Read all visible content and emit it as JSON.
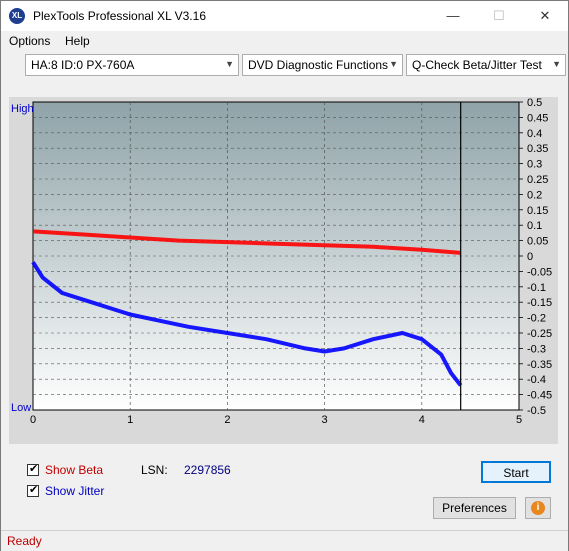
{
  "window": {
    "title": "PlexTools Professional XL V3.16",
    "icon_text": "XL"
  },
  "window_controls": {
    "minimize": "—",
    "maximize": "☐",
    "close": "✕"
  },
  "menu": {
    "items": [
      "Options",
      "Help"
    ]
  },
  "toolbar": {
    "device": "HA:8 ID:0  PX-760A",
    "function": "DVD Diagnostic Functions",
    "test": "Q-Check Beta/Jitter Test"
  },
  "chart": {
    "left_label_high": "High",
    "left_label_low": "Low"
  },
  "chart_data": {
    "type": "line",
    "xlim": [
      0,
      5
    ],
    "ylim": [
      -0.5,
      0.5
    ],
    "x_ticks": [
      "0",
      "1",
      "2",
      "3",
      "4",
      "5"
    ],
    "y_ticks": [
      "0.5",
      "0.45",
      "0.4",
      "0.35",
      "0.3",
      "0.25",
      "0.2",
      "0.15",
      "0.1",
      "0.05",
      "0",
      "-0.05",
      "-0.1",
      "-0.15",
      "-0.2",
      "-0.25",
      "-0.3",
      "-0.35",
      "-0.4",
      "-0.45",
      "-0.5"
    ],
    "end_marker_x": 4.4,
    "series": [
      {
        "color": "#ff0000",
        "x": [
          0,
          0.5,
          1.0,
          1.5,
          2.0,
          2.5,
          3.0,
          3.5,
          4.0,
          4.4
        ],
        "y": [
          0.08,
          0.07,
          0.06,
          0.05,
          0.045,
          0.04,
          0.035,
          0.03,
          0.02,
          0.01
        ]
      },
      {
        "color": "#0000ff",
        "x": [
          0,
          0.1,
          0.3,
          0.6,
          0.8,
          1.0,
          1.3,
          1.6,
          2.0,
          2.4,
          2.8,
          3.0,
          3.2,
          3.5,
          3.8,
          4.0,
          4.2,
          4.3,
          4.4
        ],
        "y": [
          -0.02,
          -0.07,
          -0.12,
          -0.15,
          -0.17,
          -0.19,
          -0.21,
          -0.23,
          -0.25,
          -0.27,
          -0.3,
          -0.31,
          -0.3,
          -0.27,
          -0.25,
          -0.27,
          -0.32,
          -0.38,
          -0.42
        ]
      }
    ]
  },
  "controls": {
    "show_beta": "Show Beta",
    "show_jitter": "Show Jitter",
    "beta_checked": true,
    "jitter_checked": true,
    "lsn_label": "LSN:",
    "lsn_value": "2297856",
    "start_button": "Start",
    "preferences_button": "Preferences",
    "info_icon": "i"
  },
  "status": {
    "text": "Ready"
  },
  "colors": {
    "beta_label": "#c00000",
    "jitter_label": "#0000c0",
    "lsn_value": "#000080"
  }
}
